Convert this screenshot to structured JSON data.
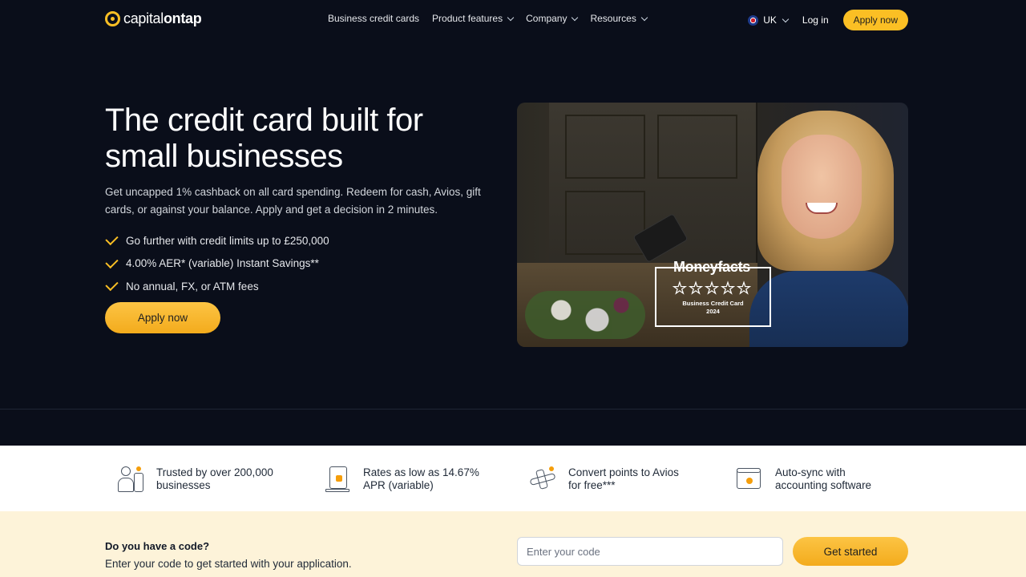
{
  "brand": {
    "name_light": "capital",
    "name_bold": "ontap",
    "accent": "#fbbf24"
  },
  "nav": {
    "links": [
      {
        "label": "Business credit cards",
        "has_dropdown": false
      },
      {
        "label": "Product features",
        "has_dropdown": true
      },
      {
        "label": "Company",
        "has_dropdown": true
      },
      {
        "label": "Resources",
        "has_dropdown": true
      }
    ],
    "locale": "UK",
    "login": "Log in",
    "apply": "Apply now"
  },
  "hero": {
    "title": "The credit card built for small businesses",
    "subtitle": "Get uncapped 1% cashback on all card spending. Redeem for cash, Avios, gift cards, or against your balance. Apply and get a decision in 2 minutes.",
    "bullets": [
      "Go further with credit limits up to £250,000",
      "4.00% AER* (variable) Instant Savings**",
      "No annual, FX, or ATM fees"
    ],
    "cta": "Apply now",
    "badge": {
      "title": "Moneyfacts",
      "stars": "★★★★★",
      "line1": "Business Credit Card",
      "line2": "2024"
    }
  },
  "features": [
    {
      "icon": "users-icon",
      "text_line1": "Trusted by over 200,000",
      "text_line2": "businesses"
    },
    {
      "icon": "percent-document-icon",
      "text_line1": "Rates as low as 14.67%",
      "text_line2": "APR (variable)"
    },
    {
      "icon": "airplane-icon",
      "text_line1": "Convert points to Avios",
      "text_line2": "for free***"
    },
    {
      "icon": "sync-calendar-icon",
      "text_line1": "Auto-sync with",
      "text_line2": "accounting software"
    }
  ],
  "code_section": {
    "question": "Do you have a code?",
    "description": "Enter your code to get started with your application.",
    "input_placeholder": "Enter your code",
    "input_value": "",
    "button": "Get started"
  }
}
